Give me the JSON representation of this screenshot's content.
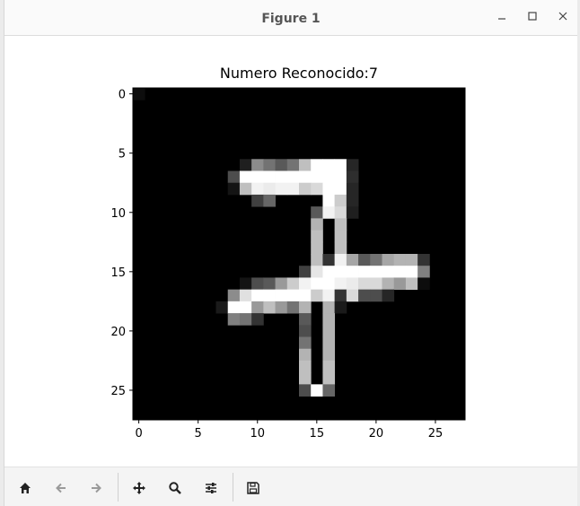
{
  "window": {
    "title": "Figure 1"
  },
  "figure": {
    "title": "Numero Reconocido:7"
  },
  "chart_data": {
    "type": "heatmap",
    "title": "Numero Reconocido:7",
    "colormap": "gray",
    "rows": 28,
    "cols": 28,
    "x_ticks": [
      0,
      5,
      10,
      15,
      20,
      25
    ],
    "y_ticks": [
      0,
      5,
      10,
      15,
      20,
      25
    ],
    "xlim": [
      -0.5,
      27.5
    ],
    "ylim": [
      27.5,
      -0.5
    ],
    "nonzero_pixels": [
      [
        0,
        0,
        0.05
      ],
      [
        6,
        9,
        0.12
      ],
      [
        6,
        10,
        0.55
      ],
      [
        6,
        11,
        0.45
      ],
      [
        6,
        12,
        0.35
      ],
      [
        6,
        13,
        0.45
      ],
      [
        6,
        14,
        0.75
      ],
      [
        6,
        15,
        1
      ],
      [
        6,
        16,
        1
      ],
      [
        6,
        17,
        1
      ],
      [
        6,
        18,
        0.15
      ],
      [
        7,
        8,
        0.3
      ],
      [
        7,
        9,
        1
      ],
      [
        7,
        10,
        1
      ],
      [
        7,
        11,
        1
      ],
      [
        7,
        12,
        1
      ],
      [
        7,
        13,
        1
      ],
      [
        7,
        14,
        1
      ],
      [
        7,
        15,
        1
      ],
      [
        7,
        16,
        1
      ],
      [
        7,
        17,
        1
      ],
      [
        7,
        18,
        0.18
      ],
      [
        8,
        8,
        0.08
      ],
      [
        8,
        9,
        0.75
      ],
      [
        8,
        10,
        0.95
      ],
      [
        8,
        11,
        0.92
      ],
      [
        8,
        12,
        0.95
      ],
      [
        8,
        13,
        0.95
      ],
      [
        8,
        14,
        0.8
      ],
      [
        8,
        15,
        0.85
      ],
      [
        8,
        16,
        1
      ],
      [
        8,
        17,
        1
      ],
      [
        8,
        18,
        0.15
      ],
      [
        9,
        10,
        0.25
      ],
      [
        9,
        11,
        0.4
      ],
      [
        9,
        16,
        1
      ],
      [
        9,
        17,
        0.8
      ],
      [
        9,
        18,
        0.15
      ],
      [
        10,
        15,
        0.35
      ],
      [
        10,
        16,
        0.95
      ],
      [
        10,
        17,
        0.85
      ],
      [
        10,
        18,
        0.12
      ],
      [
        11,
        15,
        0.7
      ],
      [
        11,
        17,
        0.75
      ],
      [
        12,
        15,
        0.75
      ],
      [
        12,
        17,
        0.75
      ],
      [
        13,
        15,
        0.75
      ],
      [
        13,
        17,
        0.75
      ],
      [
        14,
        15,
        0.75
      ],
      [
        14,
        16,
        0.2
      ],
      [
        14,
        17,
        0.95
      ],
      [
        14,
        18,
        0.65
      ],
      [
        14,
        19,
        0.35
      ],
      [
        14,
        20,
        0.45
      ],
      [
        14,
        21,
        0.65
      ],
      [
        14,
        22,
        0.7
      ],
      [
        14,
        23,
        0.7
      ],
      [
        14,
        24,
        0.2
      ],
      [
        15,
        14,
        0.25
      ],
      [
        15,
        15,
        0.9
      ],
      [
        15,
        16,
        1
      ],
      [
        15,
        17,
        1
      ],
      [
        15,
        18,
        1
      ],
      [
        15,
        19,
        1
      ],
      [
        15,
        20,
        1
      ],
      [
        15,
        21,
        1
      ],
      [
        15,
        22,
        1
      ],
      [
        15,
        23,
        1
      ],
      [
        15,
        24,
        0.5
      ],
      [
        16,
        9,
        0.08
      ],
      [
        16,
        10,
        0.3
      ],
      [
        16,
        11,
        0.35
      ],
      [
        16,
        12,
        0.6
      ],
      [
        16,
        13,
        0.8
      ],
      [
        16,
        14,
        0.95
      ],
      [
        16,
        15,
        1
      ],
      [
        16,
        16,
        1
      ],
      [
        16,
        17,
        0.95
      ],
      [
        16,
        18,
        0.92
      ],
      [
        16,
        19,
        0.85
      ],
      [
        16,
        20,
        0.85
      ],
      [
        16,
        21,
        0.7
      ],
      [
        16,
        22,
        0.6
      ],
      [
        16,
        23,
        0.75
      ],
      [
        16,
        24,
        0.05
      ],
      [
        17,
        8,
        0.55
      ],
      [
        17,
        9,
        0.88
      ],
      [
        17,
        10,
        1
      ],
      [
        17,
        11,
        1
      ],
      [
        17,
        12,
        1
      ],
      [
        17,
        13,
        1
      ],
      [
        17,
        14,
        1
      ],
      [
        17,
        15,
        0.8
      ],
      [
        17,
        16,
        0.95
      ],
      [
        17,
        17,
        0.2
      ],
      [
        17,
        18,
        0.85
      ],
      [
        17,
        19,
        0.3
      ],
      [
        17,
        20,
        0.3
      ],
      [
        17,
        21,
        0.15
      ],
      [
        18,
        7,
        0.1
      ],
      [
        18,
        8,
        1
      ],
      [
        18,
        9,
        1
      ],
      [
        18,
        10,
        0.6
      ],
      [
        18,
        11,
        0.75
      ],
      [
        18,
        12,
        0.6
      ],
      [
        18,
        13,
        0.45
      ],
      [
        18,
        14,
        0.7
      ],
      [
        18,
        16,
        0.7
      ],
      [
        18,
        17,
        0.1
      ],
      [
        19,
        8,
        0.5
      ],
      [
        19,
        9,
        0.45
      ],
      [
        19,
        10,
        0.2
      ],
      [
        19,
        14,
        0.35
      ],
      [
        19,
        16,
        0.7
      ],
      [
        20,
        14,
        0.3
      ],
      [
        20,
        16,
        0.7
      ],
      [
        21,
        14,
        0.45
      ],
      [
        21,
        16,
        0.7
      ],
      [
        22,
        14,
        0.7
      ],
      [
        22,
        16,
        0.7
      ],
      [
        23,
        14,
        0.75
      ],
      [
        23,
        16,
        0.75
      ],
      [
        24,
        14,
        0.75
      ],
      [
        24,
        16,
        0.75
      ],
      [
        25,
        14,
        0.3
      ],
      [
        25,
        15,
        1
      ],
      [
        25,
        16,
        0.4
      ]
    ]
  },
  "toolbar": {
    "items": [
      {
        "icon": "home-icon"
      },
      {
        "icon": "back-arrow-icon"
      },
      {
        "icon": "forward-arrow-icon"
      },
      {
        "icon": "pan-move-icon"
      },
      {
        "icon": "zoom-magnifier-icon"
      },
      {
        "icon": "configure-subplots-icon"
      },
      {
        "icon": "save-disk-icon"
      }
    ]
  },
  "colors": {
    "titlebar_bg": "#fafafa",
    "toolbar_bg": "#f4f4f4",
    "icon_color": "#222222",
    "disabled_icon_color": "#9a9a9a"
  }
}
